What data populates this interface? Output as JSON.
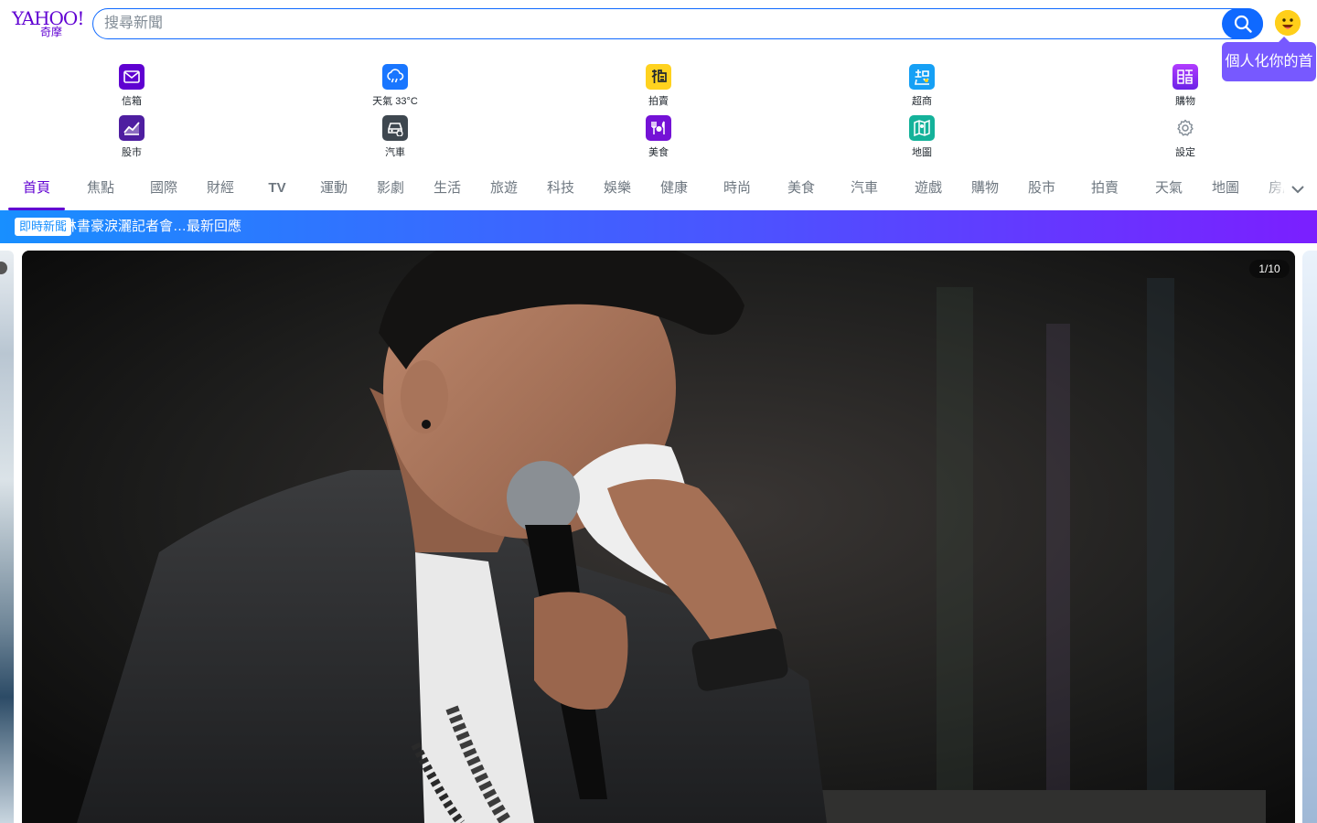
{
  "header": {
    "logo_text": "YAHOO!",
    "logo_sub": "奇摩",
    "search": {
      "placeholder": "搜尋新聞"
    }
  },
  "tooltip": "個人化你的首頁",
  "shortcuts": [
    {
      "label": "信箱",
      "icon": "mail-icon",
      "color": "#5f01d1"
    },
    {
      "label": "天氣 33°C",
      "icon": "cloud-rain-icon",
      "color": "#1976ff"
    },
    {
      "label": "拍賣",
      "icon": "auction-icon",
      "color": "#ffd21f"
    },
    {
      "label": "超商",
      "icon": "supermarket-icon",
      "color": "#16a0f5"
    },
    {
      "label": "購物",
      "icon": "shopping-icon",
      "color": "#8b2cff"
    },
    {
      "label": "股市",
      "icon": "stock-chart-icon",
      "color": "#4e1ea0"
    },
    {
      "label": "汽車",
      "icon": "car-icon",
      "color": "#3e474f"
    },
    {
      "label": "美食",
      "icon": "food-icon",
      "color": "#7412d6"
    },
    {
      "label": "地圖",
      "icon": "map-icon",
      "color": "#14b29a"
    },
    {
      "label": "設定",
      "icon": "settings-icon",
      "color": "#828c96"
    }
  ],
  "nav": {
    "tabs": [
      "首頁",
      "焦點",
      "國際",
      "財經",
      "TV",
      "運動",
      "影劇",
      "生活",
      "旅遊",
      "科技",
      "娛樂",
      "健康",
      "時尚",
      "美食",
      "汽車",
      "遊戲",
      "購物",
      "股市",
      "拍賣",
      "天氣",
      "地圖",
      "房屋"
    ],
    "active_index": 0
  },
  "banner": {
    "badge": "即時新聞",
    "text": "林書豪淚灑記者會…最新回應"
  },
  "carousel": {
    "counter": "1/10",
    "current": 1,
    "total": 10
  },
  "colors": {
    "brand": "#6001d2",
    "search_accent": "#0f69ff",
    "tooltip": "#7759ff"
  }
}
